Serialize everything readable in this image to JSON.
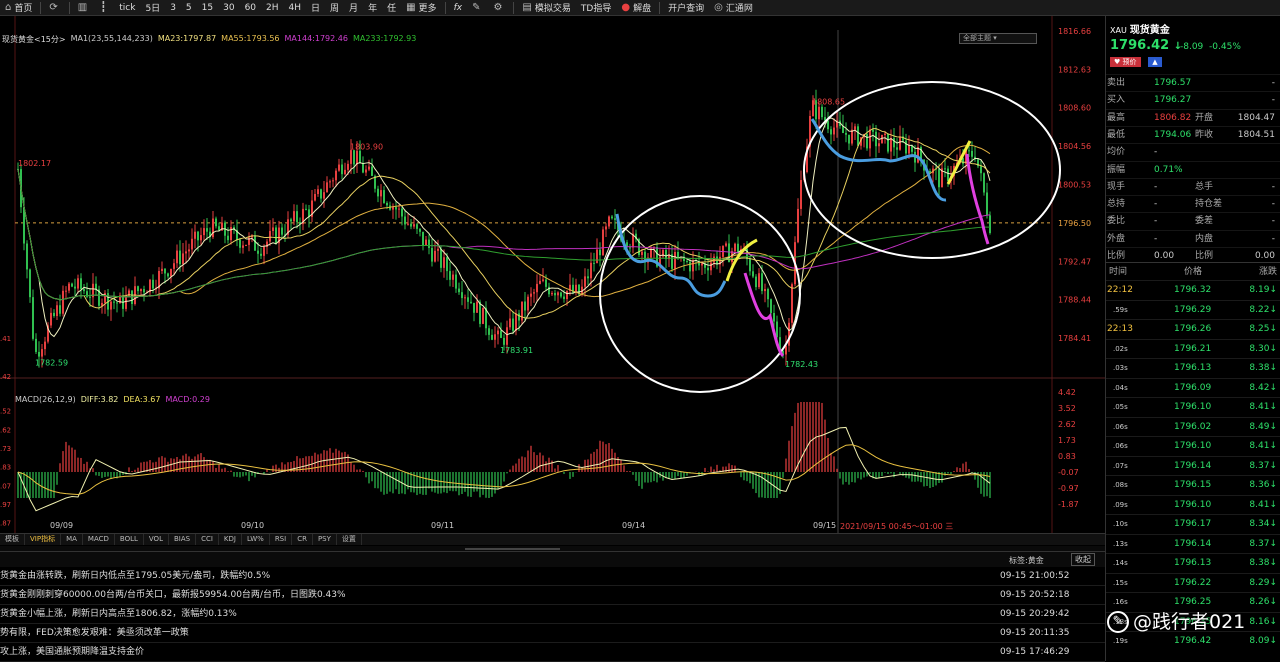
{
  "toolbar": {
    "home": "首页",
    "refresh": "",
    "intervals": [
      "tick",
      "5日",
      "3",
      "5",
      "15",
      "30",
      "60",
      "2H",
      "4H",
      "日",
      "周",
      "月",
      "年",
      "任"
    ],
    "more": "更多",
    "fx": "fx",
    "sim_trade": "模拟交易",
    "td_guide": "TD指导",
    "decode": "解盘",
    "open_account": "开户查询",
    "huitong": "汇通网"
  },
  "chart": {
    "title": "现货黄金<15分>",
    "ma_legend": [
      {
        "text": "MA1(23,55,144,233)",
        "color": "#cccccc"
      },
      {
        "text": "MA23:1797.87",
        "color": "#f0e080"
      },
      {
        "text": "MA55:1793.56",
        "color": "#e8c050"
      },
      {
        "text": "MA144:1792.46",
        "color": "#d040d0"
      },
      {
        "text": "MA233:1792.93",
        "color": "#30c030"
      }
    ],
    "theme_button": "全部主题",
    "price_labels": [
      "1816.66",
      "1812.63",
      "1808.60",
      "1804.56",
      "1800.53",
      "1796.50",
      "1792.47",
      "1788.44",
      "1784.41"
    ],
    "macd_labels": [
      "4.42",
      "3.52",
      "2.62",
      "1.73",
      "0.83",
      "-0.07",
      "-0.97",
      "-1.87"
    ],
    "left_price_labels": [
      ".41",
      ".42",
      ".52",
      ".62",
      ".73",
      ".83",
      ".07",
      ".97",
      ".87"
    ],
    "annotations": [
      "1802.17",
      "1782.59",
      "1803.90",
      "1783.91",
      "1808.65",
      "1782.43"
    ],
    "macd_legend": [
      {
        "text": "MACD(26,12,9)",
        "color": "#cccccc"
      },
      {
        "text": "DIFF:3.82",
        "color": "#f0f0a0"
      },
      {
        "text": "DEA:3.67",
        "color": "#f0e060"
      },
      {
        "text": "MACD:0.29",
        "color": "#d040d0"
      }
    ],
    "dates": [
      "09/09",
      "09/10",
      "09/11",
      "09/14",
      "09/15"
    ],
    "cursor_time": "2021/09/15 00:45～01:00 三"
  },
  "tabs": [
    "模板",
    "VIP指标",
    "MA",
    "MACD",
    "BOLL",
    "VOL",
    "BIAS",
    "CCI",
    "KDJ",
    "LW%",
    "RSI",
    "CR",
    "PSY",
    "设置"
  ],
  "news_header": {
    "tag": "标签:黄金",
    "collapse": "收起"
  },
  "news": [
    {
      "text": "货黄金由涨转跌，刷新日内低点至1795.05美元/盎司，跌幅约0.5%",
      "time": "09-15 21:00:52"
    },
    {
      "text": "货黄金刚刚刺穿60000.00台两/台币关口，最新报59954.00台两/台币，日图跌0.43%",
      "time": "09-15 20:52:18"
    },
    {
      "text": "货黄金小幅上涨，刷新日内高点至1806.82，涨幅约0.13%",
      "time": "09-15 20:29:42"
    },
    {
      "text": "势有限，FED决策愈发艰难：美亟须改革一政策",
      "time": "09-15 20:11:35"
    },
    {
      "text": "攻上涨，美国通胀预期降温支持金价",
      "time": "09-15 17:46:29"
    }
  ],
  "quote": {
    "symbol_code": "XAU",
    "symbol_name": "现货黄金",
    "price": "1796.42",
    "arrow": "↓",
    "change": "-8.09",
    "change_pct": "-0.45%",
    "fav_label": "♥ 预价",
    "rows": [
      {
        "l": "卖出",
        "v": "1796.57",
        "l2": "",
        "v2": "-",
        "c": "#2ee06a"
      },
      {
        "l": "买入",
        "v": "1796.27",
        "l2": "",
        "v2": "-",
        "c": "#2ee06a"
      },
      {
        "l": "最高",
        "v": "1806.82",
        "l2": "开盘",
        "v2": "1804.47",
        "c": "#e84040"
      },
      {
        "l": "最低",
        "v": "1794.06",
        "l2": "昨收",
        "v2": "1804.51",
        "c": "#2ee06a"
      },
      {
        "l": "均价",
        "v": "-",
        "l2": "",
        "v2": "",
        "c": "#ccc"
      },
      {
        "l": "振幅",
        "v": "0.71%",
        "l2": "",
        "v2": "",
        "c": "#2ee06a"
      },
      {
        "l": "现手",
        "v": "-",
        "l2": "总手",
        "v2": "-",
        "c": "#ccc"
      },
      {
        "l": "总持",
        "v": "-",
        "l2": "持仓差",
        "v2": "-",
        "c": "#ccc"
      },
      {
        "l": "委比",
        "v": "-",
        "l2": "委差",
        "v2": "-",
        "c": "#ccc"
      },
      {
        "l": "外盘",
        "v": "-",
        "l2": "内盘",
        "v2": "-",
        "c": "#ccc"
      },
      {
        "l": "比例",
        "v": "0.00",
        "l2": "比例",
        "v2": "0.00",
        "c": "#ccc"
      }
    ],
    "tick_header": {
      "time": "时间",
      "price": "价格",
      "change": "涨跌"
    },
    "ticks": [
      {
        "t": "22:12",
        "p": "1796.32",
        "c": "8.19↓",
        "sub": false
      },
      {
        "t": ".59s",
        "p": "1796.29",
        "c": "8.22↓",
        "sub": true
      },
      {
        "t": "22:13",
        "p": "1796.26",
        "c": "8.25↓",
        "sub": false
      },
      {
        "t": ".02s",
        "p": "1796.21",
        "c": "8.30↓",
        "sub": true
      },
      {
        "t": ".03s",
        "p": "1796.13",
        "c": "8.38↓",
        "sub": true
      },
      {
        "t": ".04s",
        "p": "1796.09",
        "c": "8.42↓",
        "sub": true
      },
      {
        "t": ".05s",
        "p": "1796.10",
        "c": "8.41↓",
        "sub": true
      },
      {
        "t": ".06s",
        "p": "1796.02",
        "c": "8.49↓",
        "sub": true
      },
      {
        "t": ".06s",
        "p": "1796.10",
        "c": "8.41↓",
        "sub": true
      },
      {
        "t": ".07s",
        "p": "1796.14",
        "c": "8.37↓",
        "sub": true
      },
      {
        "t": ".08s",
        "p": "1796.15",
        "c": "8.36↓",
        "sub": true
      },
      {
        "t": ".09s",
        "p": "1796.10",
        "c": "8.41↓",
        "sub": true
      },
      {
        "t": ".10s",
        "p": "1796.17",
        "c": "8.34↓",
        "sub": true
      },
      {
        "t": ".13s",
        "p": "1796.14",
        "c": "8.37↓",
        "sub": true
      },
      {
        "t": ".14s",
        "p": "1796.13",
        "c": "8.38↓",
        "sub": true
      },
      {
        "t": ".15s",
        "p": "1796.22",
        "c": "8.29↓",
        "sub": true
      },
      {
        "t": ".16s",
        "p": "1796.25",
        "c": "8.26↓",
        "sub": true
      },
      {
        "t": ".18s",
        "p": "1796.35",
        "c": "8.16↓",
        "sub": true
      },
      {
        "t": ".19s",
        "p": "1796.42",
        "c": "8.09↓",
        "sub": true
      }
    ]
  },
  "watermark": "@践行者021"
}
